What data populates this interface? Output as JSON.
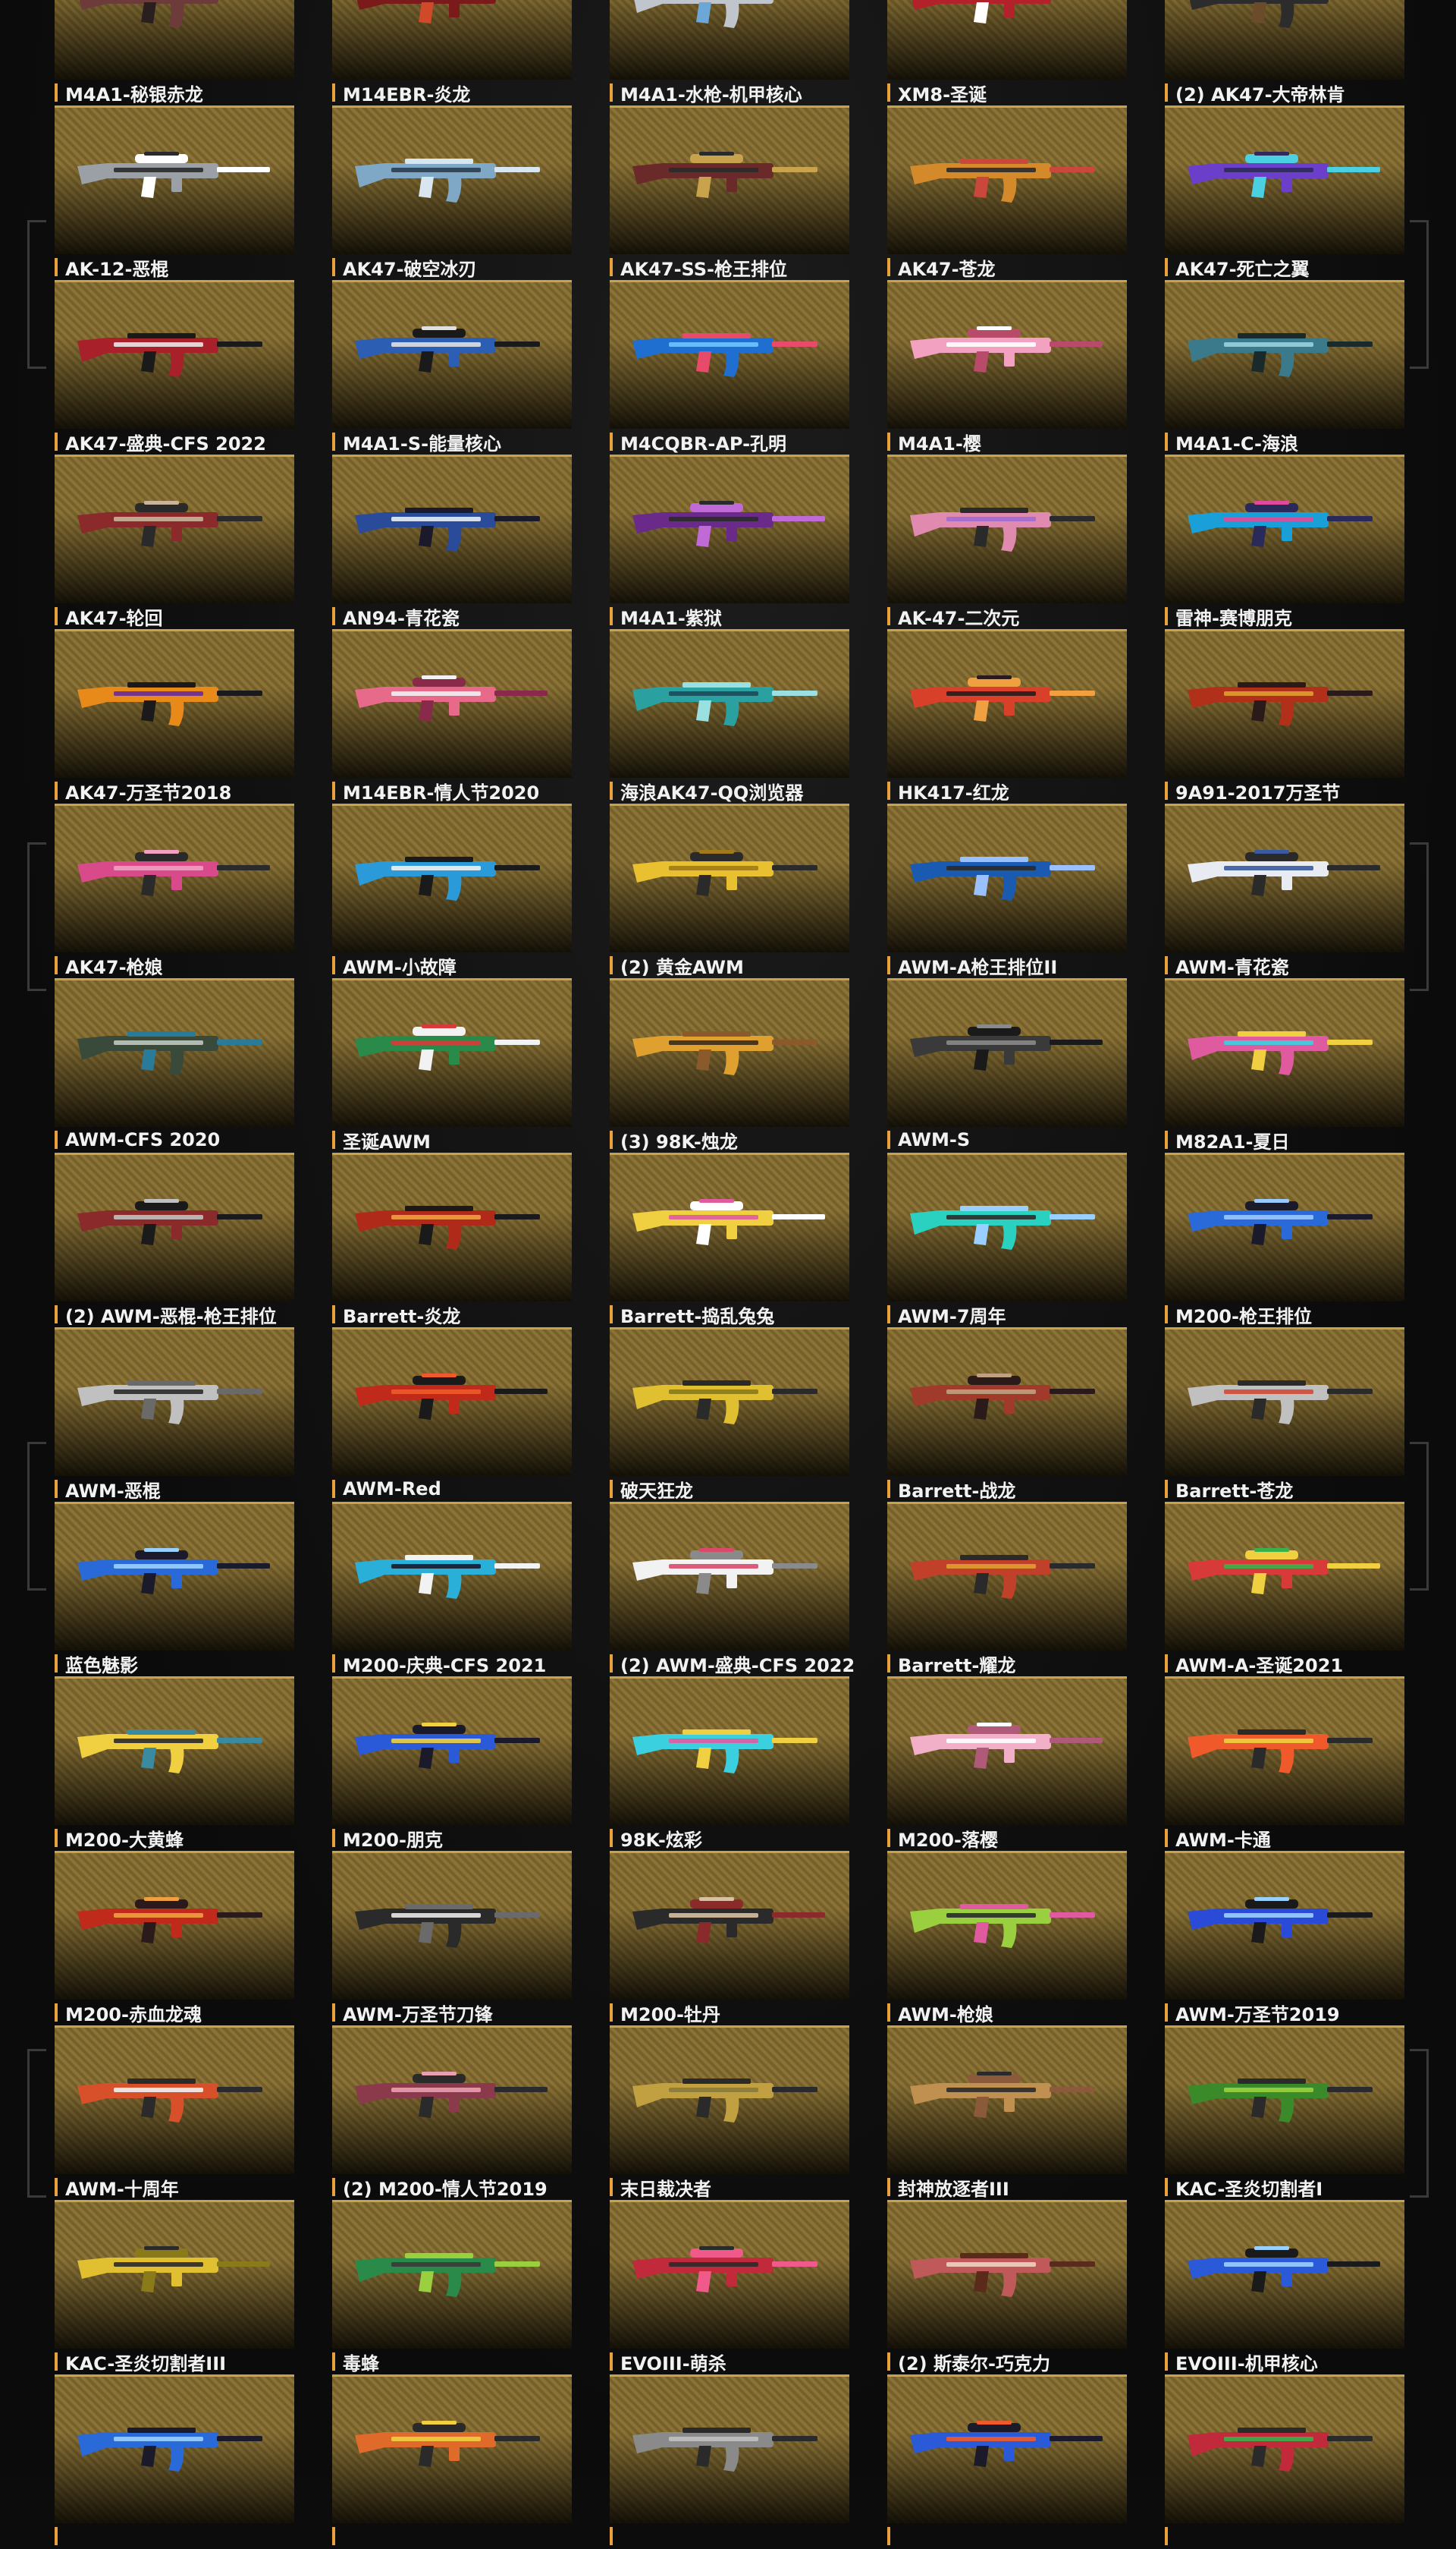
{
  "colors": {
    "background": "#0c0c0c",
    "card_pattern": "#8b7336",
    "accent_bar": "#e9a23b",
    "caption_text": "#f2f2f2"
  },
  "weapons": [
    {
      "label": "M4A1-秘银赤龙",
      "colors": [
        "#6e3b3b",
        "#d7c5b0",
        "#2a1f1f"
      ]
    },
    {
      "label": "M14EBR-炎龙",
      "colors": [
        "#7a1a1a",
        "#1b1b1b",
        "#d04a2a"
      ]
    },
    {
      "label": "M4A1-水枪-机甲核心",
      "colors": [
        "#c0c4cc",
        "#3a3f4a",
        "#6da7d8"
      ]
    },
    {
      "label": "XM8-圣诞",
      "colors": [
        "#b3212b",
        "#e7c66b",
        "#ffffff"
      ]
    },
    {
      "label": "(2) AK47-大帝林肯",
      "colors": [
        "#2c2c2c",
        "#d4b16a",
        "#6a4b2a"
      ]
    },
    {
      "label": "AK-12-恶棍",
      "colors": [
        "#9aa0a6",
        "#2a2a2a",
        "#ffffff"
      ]
    },
    {
      "label": "AK47-破空冰刃",
      "colors": [
        "#7fa7c6",
        "#2c3e50",
        "#d9e6f0"
      ]
    },
    {
      "label": "AK47-SS-枪王排位",
      "colors": [
        "#6a2a2a",
        "#2a2a2a",
        "#c9a24e"
      ]
    },
    {
      "label": "AK47-苍龙",
      "colors": [
        "#d48a2a",
        "#2a2a2a",
        "#c9473b"
      ]
    },
    {
      "label": "AK47-死亡之翼",
      "colors": [
        "#6b3fc9",
        "#2f2a5a",
        "#4ad0e0"
      ]
    },
    {
      "label": "AK47-盛典-CFS 2022",
      "colors": [
        "#a8202a",
        "#e8e8e8",
        "#1a1a1a"
      ]
    },
    {
      "label": "M4A1-S-能量核心",
      "colors": [
        "#2c5fb3",
        "#e0e0e0",
        "#1a1a1a"
      ]
    },
    {
      "label": "M4CQBR-AP-孔明",
      "colors": [
        "#1f6fd1",
        "#6fc4ff",
        "#e84a6a"
      ]
    },
    {
      "label": "M4A1-樱",
      "colors": [
        "#f2a2c0",
        "#ffffff",
        "#b84a6a"
      ]
    },
    {
      "label": "M4A1-C-海浪",
      "colors": [
        "#3a7a8a",
        "#9ad0e0",
        "#1a2a2a"
      ]
    },
    {
      "label": "AK47-轮回",
      "colors": [
        "#8a2a2a",
        "#c9b49a",
        "#2a2a2a"
      ]
    },
    {
      "label": "AN94-青花瓷",
      "colors": [
        "#2a4a9a",
        "#e6eef8",
        "#1a1a2a"
      ]
    },
    {
      "label": "M4A1-紫狱",
      "colors": [
        "#6a2a8a",
        "#2a2a2a",
        "#c06ad8"
      ]
    },
    {
      "label": "AK-47-二次元",
      "colors": [
        "#e08ab0",
        "#a06ad0",
        "#2a2a2a"
      ]
    },
    {
      "label": "雷神-赛博朋克",
      "colors": [
        "#1aa0d8",
        "#e04a9a",
        "#2a2a5a"
      ]
    },
    {
      "label": "AK47-万圣节2018",
      "colors": [
        "#e88a1a",
        "#6a2a9a",
        "#1a1a1a"
      ]
    },
    {
      "label": "M14EBR-情人节2020",
      "colors": [
        "#e86a8a",
        "#f2f2f2",
        "#8a2a4a"
      ]
    },
    {
      "label": "海浪AK47-QQ浏览器",
      "colors": [
        "#2aa0a0",
        "#1a4a5a",
        "#9ae0e0"
      ]
    },
    {
      "label": "HK417-红龙",
      "colors": [
        "#d8402a",
        "#2a1a1a",
        "#f0a040"
      ]
    },
    {
      "label": "9A91-2017万圣节",
      "colors": [
        "#b0301a",
        "#e0a030",
        "#2a1a1a"
      ]
    },
    {
      "label": "AK47-枪娘",
      "colors": [
        "#d84a8a",
        "#f0a0c0",
        "#2a2a2a"
      ]
    },
    {
      "label": "AWM-小故障",
      "colors": [
        "#2a9ad8",
        "#f2f2f2",
        "#1a1a1a"
      ]
    },
    {
      "label": "(2) 黄金AWM",
      "colors": [
        "#e8c030",
        "#a07a1a",
        "#2a2a2a"
      ]
    },
    {
      "label": "AWM-A枪王排位II",
      "colors": [
        "#1a5ab0",
        "#2a2a2a",
        "#9ac0ff"
      ]
    },
    {
      "label": "AWM-青花瓷",
      "colors": [
        "#e8ecf2",
        "#3a5aa0",
        "#2a2a2a"
      ]
    },
    {
      "label": "AWM-CFS 2020",
      "colors": [
        "#3a4a3a",
        "#c0c8c0",
        "#2a7a9a"
      ]
    },
    {
      "label": "圣诞AWM",
      "colors": [
        "#2a8a4a",
        "#d83a3a",
        "#f2f2f2"
      ]
    },
    {
      "label": "(3) 98K-烛龙",
      "colors": [
        "#e0a030",
        "#3a2a1a",
        "#8a5a2a"
      ]
    },
    {
      "label": "AWM-S",
      "colors": [
        "#3a3a3a",
        "#8a8a8a",
        "#1a1a1a"
      ]
    },
    {
      "label": "M82A1-夏日",
      "colors": [
        "#e05aa0",
        "#3ad0e0",
        "#f0d040"
      ]
    },
    {
      "label": "(2) AWM-恶棍-枪王排位",
      "colors": [
        "#8a2a2a",
        "#c0c0c0",
        "#1a1a1a"
      ]
    },
    {
      "label": "Barrett-炎龙",
      "colors": [
        "#b02a1a",
        "#f0a040",
        "#1a1a1a"
      ]
    },
    {
      "label": "Barrett-捣乱兔兔",
      "colors": [
        "#f0d040",
        "#e05aa0",
        "#ffffff"
      ]
    },
    {
      "label": "AWM-7周年",
      "colors": [
        "#2ad0c0",
        "#2a2a2a",
        "#9ad0ff"
      ]
    },
    {
      "label": "M200-枪王排位",
      "colors": [
        "#2a6ad8",
        "#9ac8ff",
        "#1a1a2a"
      ]
    },
    {
      "label": "AWM-恶棍",
      "colors": [
        "#c0c0c0",
        "#2a2a2a",
        "#6a6a6a"
      ]
    },
    {
      "label": "AWM-Red",
      "colors": [
        "#c02a1a",
        "#f05a2a",
        "#1a1a1a"
      ]
    },
    {
      "label": "破天狂龙",
      "colors": [
        "#e0c030",
        "#8a7a1a",
        "#2a2a2a"
      ]
    },
    {
      "label": "Barrett-战龙",
      "colors": [
        "#a03a2a",
        "#c0a080",
        "#2a1a1a"
      ]
    },
    {
      "label": "Barrett-苍龙",
      "colors": [
        "#c0c0c0",
        "#d04a3a",
        "#2a2a2a"
      ]
    },
    {
      "label": "蓝色魅影",
      "colors": [
        "#2a6ad8",
        "#9ad0ff",
        "#1a1a2a"
      ]
    },
    {
      "label": "M200-庆典-CFS 2021",
      "colors": [
        "#2ab0d8",
        "#1a1a2a",
        "#f2f2f2"
      ]
    },
    {
      "label": "(2) AWM-盛典-CFS 2022",
      "colors": [
        "#f2f2f2",
        "#d84a6a",
        "#8a8a8a"
      ]
    },
    {
      "label": "Barrett-耀龙",
      "colors": [
        "#c0402a",
        "#e0a030",
        "#2a2a2a"
      ]
    },
    {
      "label": "AWM-A-圣诞2021",
      "colors": [
        "#d83a3a",
        "#3ab04a",
        "#f0d040"
      ]
    },
    {
      "label": "M200-大黄蜂",
      "colors": [
        "#f0d040",
        "#2a2a2a",
        "#3a8aa0"
      ]
    },
    {
      "label": "M200-朋克",
      "colors": [
        "#2a5ad8",
        "#f0d040",
        "#1a1a2a"
      ]
    },
    {
      "label": "98K-炫彩",
      "colors": [
        "#3ad0e0",
        "#e05aa0",
        "#f0d040"
      ]
    },
    {
      "label": "M200-落樱",
      "colors": [
        "#f2b0c8",
        "#ffffff",
        "#b05a7a"
      ]
    },
    {
      "label": "AWM-卡通",
      "colors": [
        "#f05a2a",
        "#f0d040",
        "#2a2a2a"
      ]
    },
    {
      "label": "M200-赤血龙魂",
      "colors": [
        "#c02a1a",
        "#f0a040",
        "#2a1a1a"
      ]
    },
    {
      "label": "AWM-万圣节刀锋",
      "colors": [
        "#2a2a2a",
        "#e8e8e8",
        "#6a6a6a"
      ]
    },
    {
      "label": "M200-牡丹",
      "colors": [
        "#2a2a2a",
        "#d8c0a0",
        "#8a2a2a"
      ]
    },
    {
      "label": "AWM-枪娘",
      "colors": [
        "#9ad040",
        "#2a2a2a",
        "#e05aa0"
      ]
    },
    {
      "label": "AWM-万圣节2019",
      "colors": [
        "#2a4ad8",
        "#9ad0ff",
        "#1a1a1a"
      ]
    },
    {
      "label": "AWM-十周年",
      "colors": [
        "#d8502a",
        "#f2f2f2",
        "#2a2a2a"
      ]
    },
    {
      "label": "(2) M200-情人节2019",
      "colors": [
        "#8a3a4a",
        "#e8a0b0",
        "#2a2a2a"
      ]
    },
    {
      "label": "末日裁决者",
      "colors": [
        "#c0a040",
        "#8a7a3a",
        "#2a2a2a"
      ]
    },
    {
      "label": "封神放逐者III",
      "colors": [
        "#c09050",
        "#2a2a2a",
        "#8a5a3a"
      ]
    },
    {
      "label": "KAC-圣炎切割者I",
      "colors": [
        "#3a8a2a",
        "#9ad040",
        "#2a2a2a"
      ]
    },
    {
      "label": "KAC-圣炎切割者III",
      "colors": [
        "#e0c030",
        "#2a2a2a",
        "#8a7a1a"
      ]
    },
    {
      "label": "毒蜂",
      "colors": [
        "#2a8a4a",
        "#3a3a3a",
        "#9ad040"
      ]
    },
    {
      "label": "EVOIII-萌杀",
      "colors": [
        "#c02a3a",
        "#2a2a2a",
        "#f05a8a"
      ]
    },
    {
      "label": "(2) 斯泰尔-巧克力",
      "colors": [
        "#c05a5a",
        "#f0d0c0",
        "#5a2a1a"
      ]
    },
    {
      "label": "EVOIII-机甲核心",
      "colors": [
        "#2a5ad8",
        "#9ad0ff",
        "#1a1a1a"
      ]
    },
    {
      "label": "",
      "colors": [
        "#2a6ad8",
        "#9ad0ff",
        "#1a1a2a"
      ]
    },
    {
      "label": "",
      "colors": [
        "#e06a2a",
        "#f0d040",
        "#2a2a2a"
      ]
    },
    {
      "label": "",
      "colors": [
        "#8a8a8a",
        "#c0c0c0",
        "#2a2a2a"
      ]
    },
    {
      "label": "",
      "colors": [
        "#2a5ad8",
        "#f05a2a",
        "#1a1a2a"
      ]
    },
    {
      "label": "",
      "colors": [
        "#c02a3a",
        "#3ab04a",
        "#2a2a2a"
      ]
    }
  ]
}
